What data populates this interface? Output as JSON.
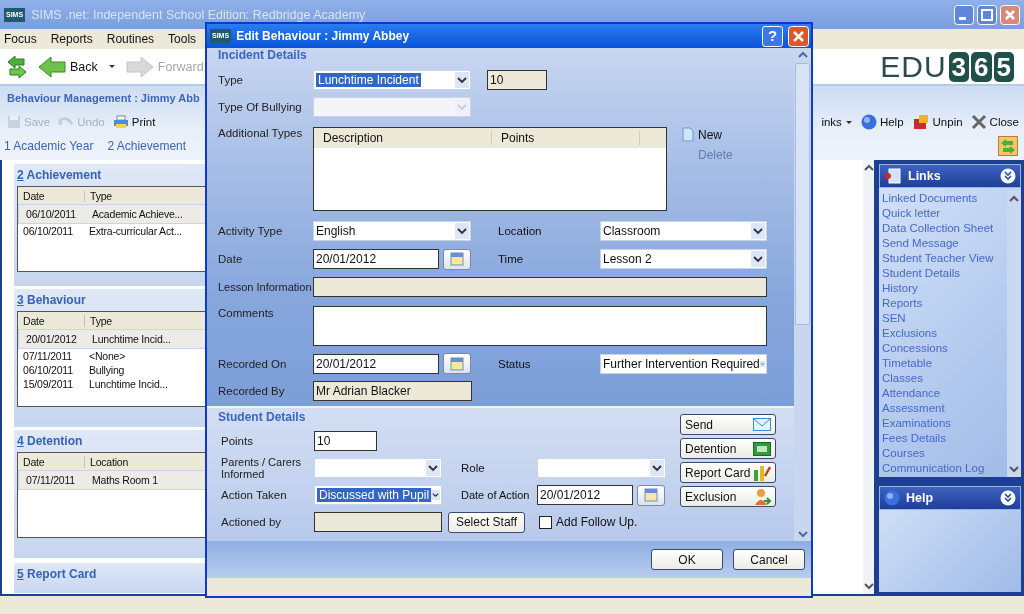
{
  "window": {
    "badge": "SIMS",
    "title": "SIMS .net: Independent School Edition: Redbridge Academy"
  },
  "menu": [
    "Focus",
    "Reports",
    "Routines",
    "Tools"
  ],
  "nav_buttons": [
    {
      "label": "Back",
      "disabled": false
    },
    {
      "label": "Forward",
      "disabled": true
    }
  ],
  "logo": {
    "text": "EDU",
    "digits": [
      "3",
      "6",
      "5"
    ]
  },
  "page": {
    "title": "Behaviour Management : Jimmy Abb",
    "actions": [
      {
        "kind": "save",
        "label": "Save",
        "disabled": true
      },
      {
        "kind": "undo",
        "label": "Undo",
        "disabled": true
      },
      {
        "kind": "print",
        "label": "Print",
        "disabled": false
      }
    ],
    "sections": [
      "1 Academic Year",
      "2 Achievement"
    ],
    "tools": [
      {
        "kind": "links",
        "label": "inks"
      },
      {
        "kind": "help",
        "label": "Help"
      },
      {
        "kind": "unpin",
        "label": "Unpin"
      },
      {
        "kind": "close",
        "label": "Close"
      }
    ]
  },
  "panels": [
    {
      "number": "2",
      "title": "Achievement",
      "columns": [
        "Date",
        "Type"
      ],
      "rows": [
        {
          "cells": [
            "06/10/2011",
            "Academic Achieve..."
          ],
          "selected": true
        },
        {
          "cells": [
            "06/10/2011",
            "Extra-curricular Act..."
          ],
          "selected": false
        }
      ]
    },
    {
      "number": "3",
      "title": "Behaviour",
      "columns": [
        "Date",
        "Type"
      ],
      "rows": [
        {
          "cells": [
            "20/01/2012",
            "Lunchtime Incid..."
          ],
          "selected": true
        },
        {
          "cells": [
            "07/11/2011",
            "<None>"
          ],
          "selected": false
        },
        {
          "cells": [
            "06/10/2011",
            "Bullying"
          ],
          "selected": false
        },
        {
          "cells": [
            "15/09/2011",
            "Lunchtime Incid..."
          ],
          "selected": false
        }
      ]
    },
    {
      "number": "4",
      "title": "Detention",
      "columns": [
        "Date",
        "Location"
      ],
      "rows": [
        {
          "cells": [
            "07/11/2011",
            "Maths Room 1"
          ],
          "selected": true
        }
      ]
    },
    {
      "number": "5",
      "title": "Report Card"
    }
  ],
  "links": {
    "title": "Links",
    "items": [
      "Linked Documents",
      "Quick letter",
      "Data Collection Sheet",
      "Send Message",
      "Student Teacher View",
      "Student Details",
      "History",
      "Reports",
      "SEN",
      "Exclusions",
      "Concessions",
      "Timetable",
      "Classes",
      "Attendance",
      "Assessment",
      "Examinations",
      "Fees Details",
      "Courses",
      "Communication Log"
    ]
  },
  "help": {
    "title": "Help"
  },
  "dialog": {
    "badge": "SIMS",
    "title": "Edit Behaviour : Jimmy Abbey",
    "help": "?",
    "incident": {
      "heading": "Incident Details",
      "type": {
        "label": "Type",
        "value": "Lunchtime Incident",
        "highlighted": true,
        "points": "10"
      },
      "bullying": {
        "label": "Type Of Bullying",
        "disabled": true
      },
      "additional": {
        "label": "Additional Types",
        "columns": [
          "Description",
          "Points"
        ],
        "new": "New",
        "delete": {
          "label": "Delete",
          "disabled": true
        }
      },
      "activity": {
        "label": "Activity Type",
        "value": "English"
      },
      "location": {
        "label": "Location",
        "value": "Classroom"
      },
      "date": {
        "label": "Date",
        "value": "20/01/2012"
      },
      "time": {
        "label": "Time",
        "value": "Lesson 2"
      },
      "lesson": {
        "label": "Lesson Information"
      },
      "comments": {
        "label": "Comments"
      },
      "recorded_on": {
        "label": "Recorded On",
        "value": "20/01/2012"
      },
      "status": {
        "label": "Status",
        "value": "Further Intervention Required"
      },
      "recorded_by": {
        "label": "Recorded By",
        "value": "Mr Adrian Blacker"
      }
    },
    "student": {
      "heading": "Student Details",
      "points": {
        "label": "Points",
        "value": "10"
      },
      "parents": {
        "label": "Parents / Carers Informed"
      },
      "role": {
        "label": "Role"
      },
      "action": {
        "label": "Action Taken",
        "value": "Discussed with Pupil",
        "highlighted": true
      },
      "date_of_action": {
        "label": "Date of Action",
        "value": "20/01/2012"
      },
      "actioned_by": {
        "label": "Actioned by"
      },
      "select_staff": "Select Staff",
      "follow_up": {
        "label": "Add Follow Up.",
        "checked": false
      },
      "buttons": [
        {
          "kind": "send",
          "label": "Send"
        },
        {
          "kind": "detention",
          "label": "Detention"
        },
        {
          "kind": "report",
          "label": "Report Card"
        },
        {
          "kind": "exclusion",
          "label": "Exclusion"
        }
      ]
    },
    "footer": [
      "OK",
      "Cancel"
    ]
  }
}
